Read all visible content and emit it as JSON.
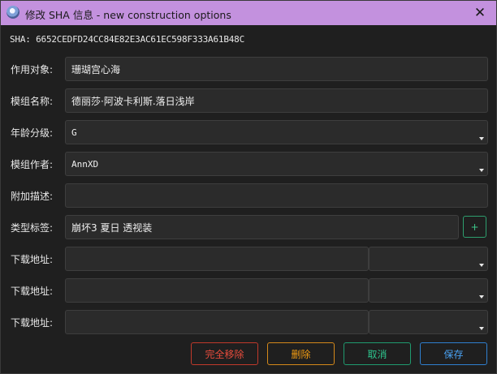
{
  "window": {
    "title": "修改 SHA 信息 - new construction options",
    "close_glyph": "✕"
  },
  "sha": {
    "text": "SHA: 6652CEDFD24CC84E82E3AC61EC598F333A61B48C"
  },
  "form": {
    "target_label": "作用对象:",
    "target_value": "珊瑚宫心海",
    "mod_name_label": "模组名称:",
    "mod_name_value": "德丽莎·阿波卡利斯.落日浅岸",
    "age_label": "年龄分级:",
    "age_value": "G",
    "author_label": "模组作者:",
    "author_value": "AnnXD",
    "desc_label": "附加描述:",
    "desc_value": "",
    "tags_label": "类型标签:",
    "tags_value": "崩坏3 夏日 透视装",
    "add_tag_glyph": "+",
    "download_label": "下载地址:",
    "downloads": [
      {
        "url": "",
        "type": ""
      },
      {
        "url": "",
        "type": ""
      },
      {
        "url": "",
        "type": ""
      }
    ]
  },
  "buttons": {
    "remove_all": "完全移除",
    "delete": "删除",
    "cancel": "取消",
    "save": "保存"
  },
  "colors": {
    "titlebar": "#c391de",
    "danger": "#e74c3c",
    "warning": "#f39c12",
    "success": "#2ec58d",
    "primary": "#4aa3f5"
  },
  "icons": {
    "app": "app-icon",
    "close": "close-icon",
    "dropdown": "chevron-down-icon",
    "add": "plus-icon"
  }
}
